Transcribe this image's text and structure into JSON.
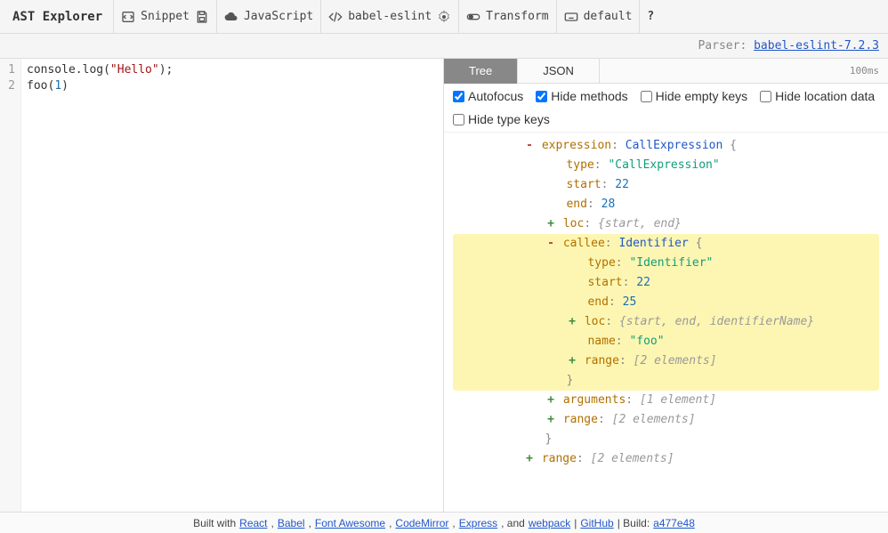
{
  "toolbar": {
    "title": "AST Explorer",
    "snippet": "Snippet",
    "language": "JavaScript",
    "parser": "babel-eslint",
    "transform": "Transform",
    "keymap": "default",
    "help": "?"
  },
  "parser_bar": {
    "label": "Parser:",
    "version": "babel-eslint-7.2.3"
  },
  "editor": {
    "lines": [
      "1",
      "2"
    ],
    "code": {
      "l1_pre": "console.log(",
      "l1_str": "\"Hello\"",
      "l1_post": ");",
      "l2_pre": "foo(",
      "l2_num": "1",
      "l2_post": ")"
    }
  },
  "ast": {
    "tabs": {
      "tree": "Tree",
      "json": "JSON"
    },
    "time": "100ms",
    "options": {
      "autofocus": "Autofocus",
      "hide_methods": "Hide methods",
      "hide_empty_keys": "Hide empty keys",
      "hide_location": "Hide location data",
      "hide_type_keys": "Hide type keys"
    },
    "tree": {
      "expression_key": "expression",
      "expression_type": "CallExpression",
      "type_key": "type",
      "type_val": "\"CallExpression\"",
      "start_key": "start",
      "start_val": "22",
      "end_key": "end",
      "end_val": "28",
      "loc_key": "loc",
      "loc_hint": "{start, end}",
      "callee_key": "callee",
      "callee_type": "Identifier",
      "callee_type_val": "\"Identifier\"",
      "callee_start": "22",
      "callee_end": "25",
      "callee_loc_hint": "{start, end, identifierName}",
      "name_key": "name",
      "name_val": "\"foo\"",
      "range_key": "range",
      "range_hint": "[2 elements]",
      "arguments_key": "arguments",
      "arguments_hint": "[1 element]",
      "outer_range_hint": "[2 elements]"
    }
  },
  "footer": {
    "built_with": "Built with",
    "react": "React",
    "babel": "Babel",
    "fa": "Font Awesome",
    "cm": "CodeMirror",
    "express": "Express",
    "and": ", and",
    "webpack": "webpack",
    "github": "GitHub",
    "build_label": "| Build:",
    "build": "a477e48"
  }
}
